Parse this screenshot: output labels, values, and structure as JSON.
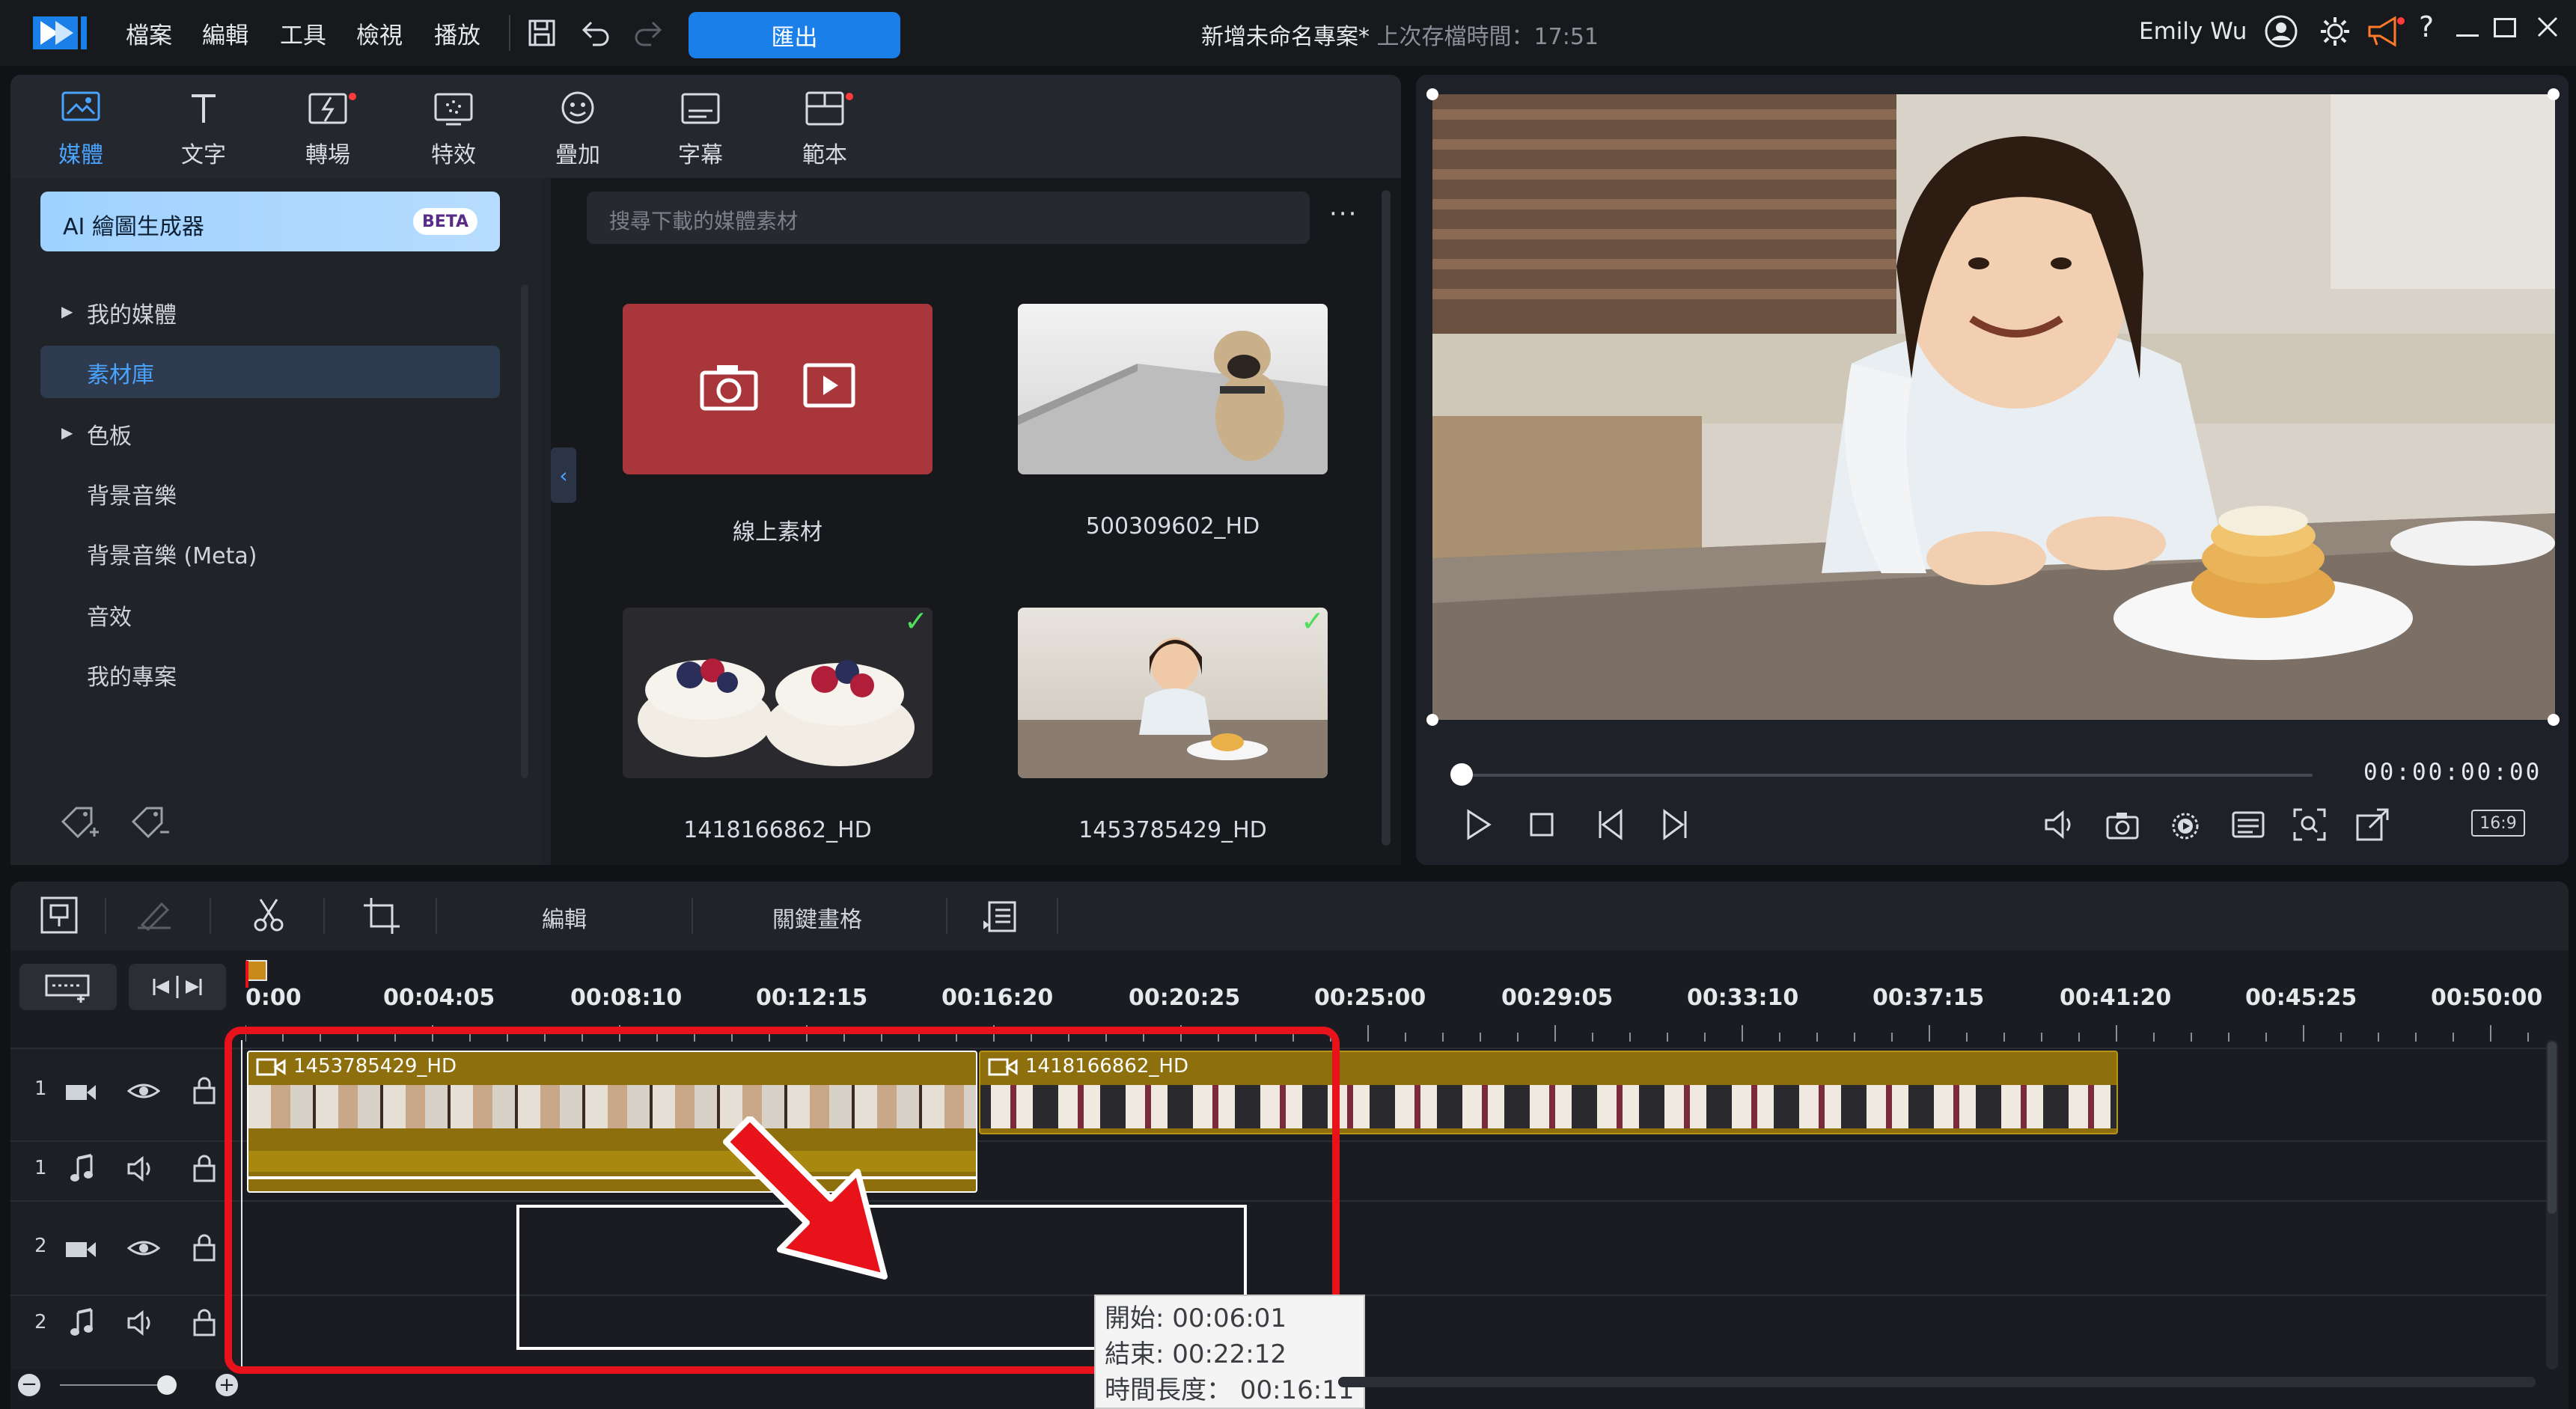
{
  "titlebar": {
    "menus": [
      "檔案",
      "編輯",
      "工具",
      "檢視",
      "播放"
    ],
    "export_label": "匯出",
    "project_title": "新增未命名專案*",
    "last_saved": "上次存檔時間：17:51",
    "user_name": "Emily Wu"
  },
  "library_tabs": [
    {
      "label": "媒體",
      "icon": "media-icon"
    },
    {
      "label": "文字",
      "icon": "text-icon"
    },
    {
      "label": "轉場",
      "icon": "transition-icon"
    },
    {
      "label": "特效",
      "icon": "effects-icon"
    },
    {
      "label": "疊加",
      "icon": "overlay-icon"
    },
    {
      "label": "字幕",
      "icon": "subtitles-icon"
    },
    {
      "label": "範本",
      "icon": "template-icon"
    }
  ],
  "sidebar": {
    "ai_generator": "AI 繪圖生成器",
    "beta": "BETA",
    "items": [
      {
        "label": "我的媒體",
        "expandable": true
      },
      {
        "label": "素材庫",
        "selected": true
      },
      {
        "label": "色板",
        "expandable": true
      },
      {
        "label": "背景音樂"
      },
      {
        "label": "背景音樂 (Meta)"
      },
      {
        "label": "音效"
      },
      {
        "label": "我的專案"
      }
    ]
  },
  "media": {
    "search_placeholder": "搜尋下載的媒體素材",
    "more": "···",
    "items": [
      {
        "label": "線上素材",
        "kind": "online"
      },
      {
        "label": "500309602_HD",
        "kind": "pug"
      },
      {
        "label": "1418166862_HD",
        "kind": "cakes",
        "checked": true
      },
      {
        "label": "1453785429_HD",
        "kind": "girl",
        "checked": true
      }
    ]
  },
  "preview": {
    "timecode": "00:00:00:00",
    "aspect": "16:9"
  },
  "timeline": {
    "toolbar": {
      "edit": "編輯",
      "keyframe": "關鍵畫格"
    },
    "ruler": [
      "0:00",
      "00:04:05",
      "00:08:10",
      "00:12:15",
      "00:16:20",
      "00:20:25",
      "00:25:00",
      "00:29:05",
      "00:33:10",
      "00:37:15",
      "00:41:20",
      "00:45:25",
      "00:50:00"
    ],
    "tracks": [
      {
        "num": "1",
        "type": "video"
      },
      {
        "num": "1",
        "type": "audio"
      },
      {
        "num": "2",
        "type": "video"
      },
      {
        "num": "2",
        "type": "audio"
      }
    ],
    "clips": [
      {
        "name": "1453785429_HD"
      },
      {
        "name": "1418166862_HD"
      }
    ],
    "tooltip": {
      "start": "開始: 00:06:01",
      "end": "結束: 00:22:12",
      "duration": "時間長度： 00:16:11"
    }
  },
  "colors": {
    "accent": "#1a7fe8",
    "clip": "#8d6f0d",
    "highlight": "#e8121a"
  }
}
